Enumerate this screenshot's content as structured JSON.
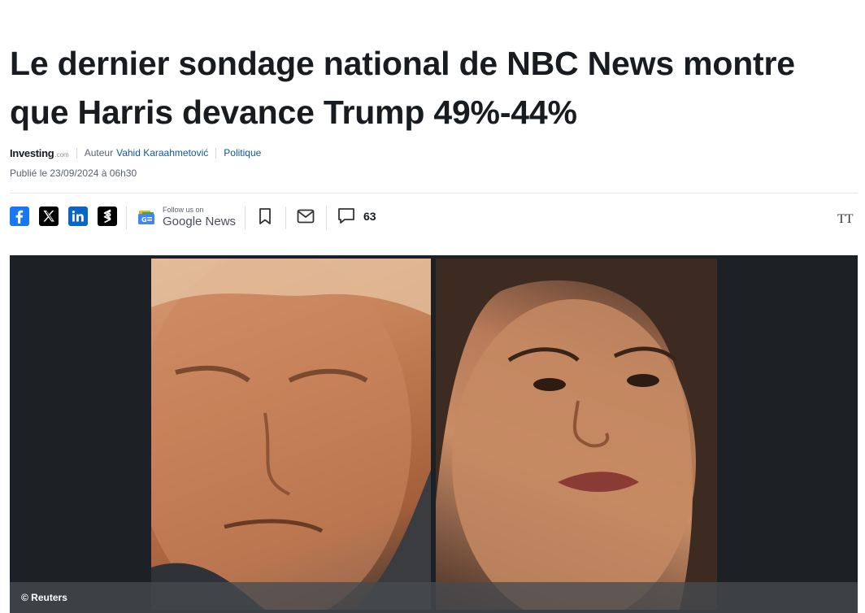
{
  "article": {
    "title": "Le dernier sondage national de NBC News montre que Harris devance Trump 49%-44%",
    "source_brand": "Investing",
    "source_brand_suffix": ".com",
    "author_prefix": "Auteur",
    "author_name": "Vahid Karaahmetović",
    "category": "Politique",
    "published": "Publié le 23/09/2024 à 06h30"
  },
  "share": {
    "icons": [
      "facebook-icon",
      "x-twitter-icon",
      "linkedin-icon",
      "stocktwits-icon"
    ],
    "google_news_small": "Follow us on",
    "google_news_big": "Google News",
    "comment_count": "63",
    "font_size_label": "TT"
  },
  "media": {
    "credit": "© Reuters"
  },
  "colors": {
    "facebook": "#1877f2",
    "x": "#000000",
    "linkedin": "#0a66c2",
    "stocktwits": "#000000",
    "link": "#1256a0",
    "media_bg": "#1d2024"
  }
}
